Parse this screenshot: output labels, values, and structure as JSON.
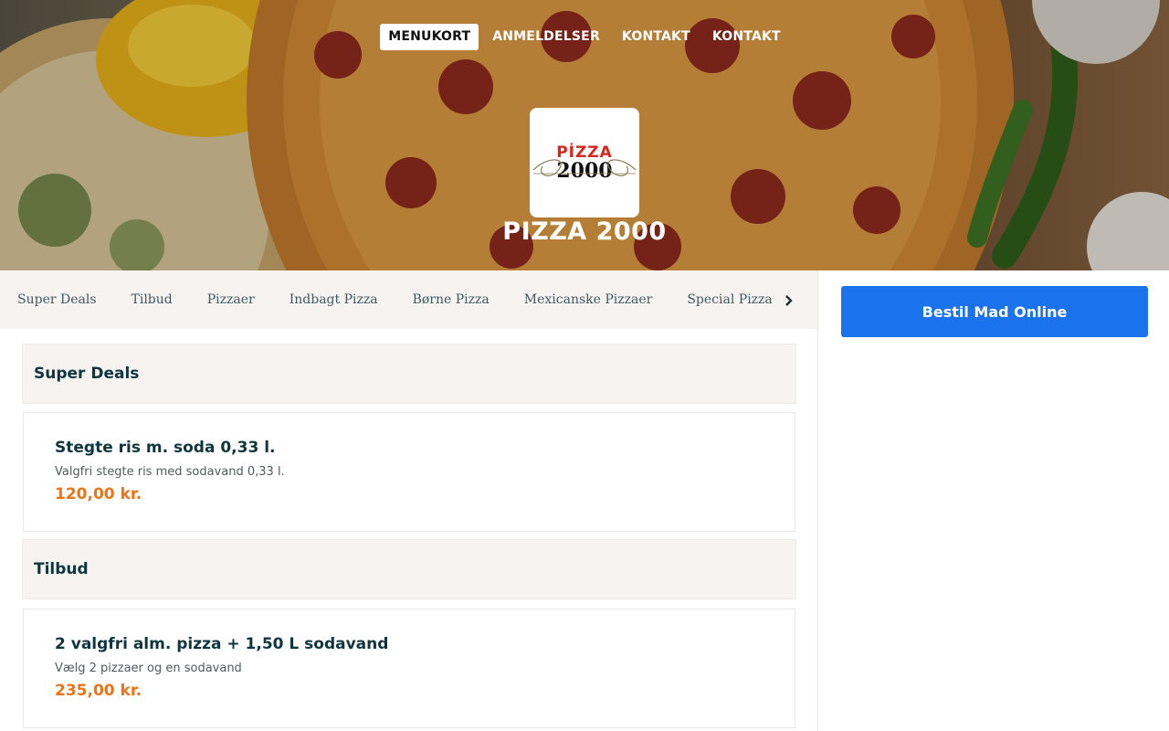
{
  "nav": {
    "items": [
      {
        "label": "MENUKORT",
        "active": true
      },
      {
        "label": "ANMELDELSER",
        "active": false
      },
      {
        "label": "KONTAKT",
        "active": false
      },
      {
        "label": "KONTAKT",
        "active": false
      }
    ]
  },
  "restaurant": {
    "logo_top": "PİZZA",
    "logo_number": "2000",
    "name": "PIZZA 2000"
  },
  "categories": [
    "Super Deals",
    "Tilbud",
    "Pizzaer",
    "Indbagt Pizza",
    "Børne Pizza",
    "Mexicanske Pizzaer",
    "Special Pizza"
  ],
  "order_button": "Bestil Mad Online",
  "menu": {
    "sections": [
      {
        "title": "Super Deals",
        "items": [
          {
            "name": "Stegte ris m. soda 0,33 l.",
            "description": "Valgfri stegte ris med sodavand 0,33 l.",
            "price": "120,00 kr."
          }
        ]
      },
      {
        "title": "Tilbud",
        "items": [
          {
            "name": "2 valgfri alm. pizza + 1,50 L sodavand",
            "description": "Vælg 2 pizzaer og en sodavand",
            "price": "235,00 kr."
          }
        ]
      }
    ]
  },
  "colors": {
    "primary_button": "#1a73ec",
    "price": "#ef7312",
    "heading": "#0f3640",
    "logo_red": "#d9261c"
  },
  "icons": {
    "category_scroll": "chevron-right-icon"
  }
}
